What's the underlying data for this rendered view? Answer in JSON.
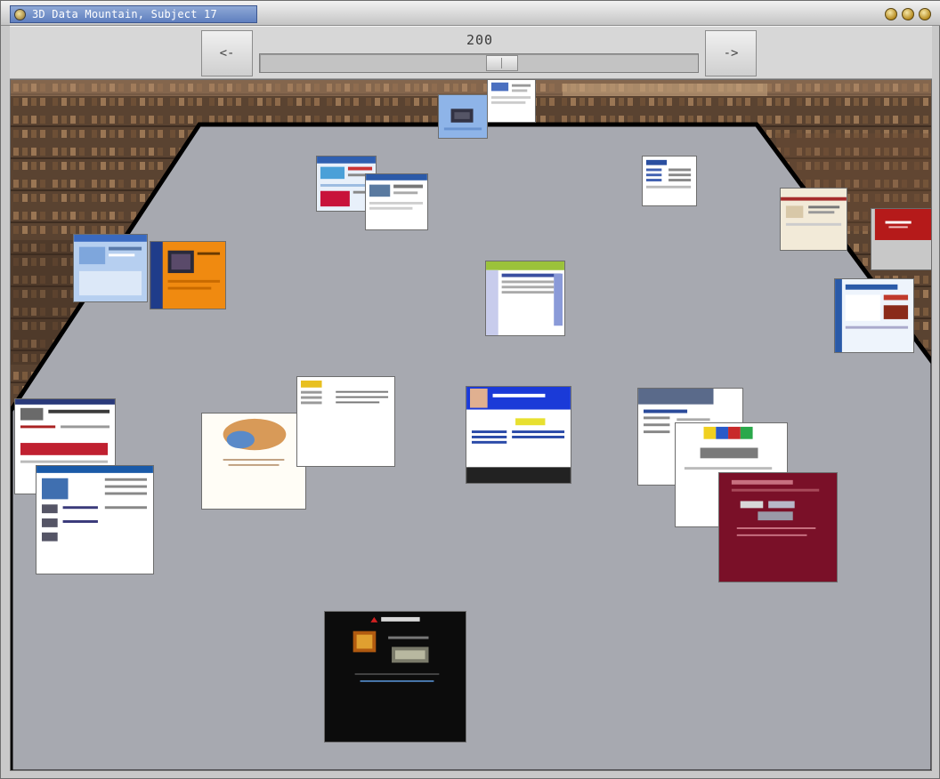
{
  "window": {
    "title": "3D Data Mountain, Subject 17",
    "controls": [
      "minimize-icon",
      "maximize-icon",
      "close-icon"
    ]
  },
  "toolbar": {
    "prev_label": "<-",
    "next_label": "->",
    "slider_value": "200"
  },
  "colors": {
    "mountain": "#a7a9b0",
    "mountain_edge": "#000000",
    "title_pill": "#6f8cc7",
    "toolbar": "#d7d7d7"
  }
}
